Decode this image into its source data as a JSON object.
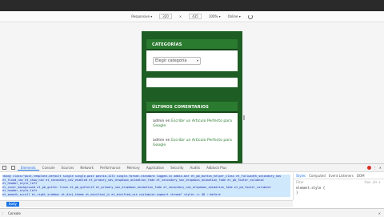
{
  "device_toolbar": {
    "device": "Responsive",
    "width": "320",
    "x": "×",
    "height": "435",
    "zoom": "100%",
    "throttle": "Online"
  },
  "widgets": {
    "categories_title": "CATEGORÍAS",
    "categories_select": "Elegir categoría",
    "comments_title": "ÚLTIMOS COMENTARIOS",
    "comments": [
      {
        "author": "admin",
        "sep": " en ",
        "link": "Escribir un Artículo Perfecto para Google"
      },
      {
        "author": "admin",
        "sep": " en ",
        "link": "Escribir un Artículo Perfecto para Google"
      }
    ]
  },
  "devtools": {
    "tabs": [
      "Elements",
      "Console",
      "Sources",
      "Network",
      "Performance",
      "Memory",
      "Application",
      "Security",
      "Audits",
      "Adblock Plus"
    ],
    "active_tab": "Elements",
    "html_lines": [
      "<body class=\"post-template-default single single-post postid-1172 single-format-standard logged-in admin-bar et_pb_button_helper_class et_fullwidth_secondary_nav",
      "et_fixed_nav et_show_nav et_secondary_nav_enabled et_primary_nav_dropdown_animation_fade et_secondary_nav_dropdown_animation_fade et_pb_footer_columns4 et_header_style_left",
      "et_cover_background et_pb_gutter linux et_pb_gutters3 et_primary_nav_dropdown_animation_fade et_secondary_nav_dropdown_animation_fade et_pb_footer_columns4 et_header_style_left",
      "et_smooth_scroll et_right_sidebar et_divi_theme et_minified_js et_minified_css customize-support chrome\" style>  == $0  ::before"
    ],
    "side_tabs": [
      "Styles",
      "Computed",
      "Event Listeners",
      "DOM"
    ],
    "filter": "Filter",
    "filter_flags": ":hov .cls +",
    "rule": "element.style {",
    "rule_close": "}",
    "breadcrumb": "body",
    "console_label": "Console"
  }
}
